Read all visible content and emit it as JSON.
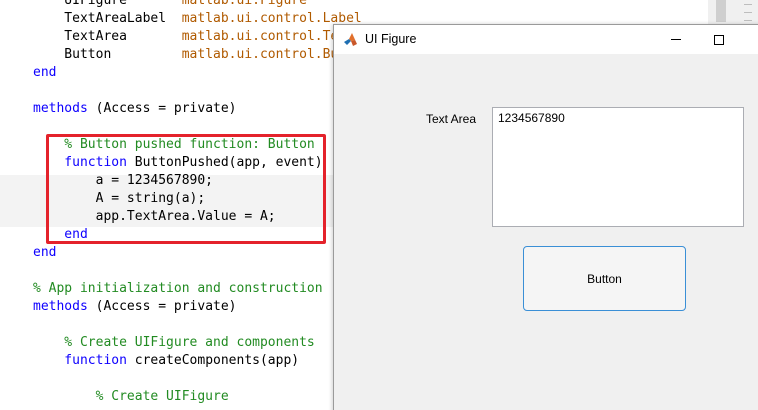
{
  "editor": {
    "lines": [
      {
        "segments": [
          {
            "cls": "plain",
            "text": "    UIFigure       "
          },
          {
            "cls": "cls",
            "text": "matlab.ui.Figure"
          }
        ]
      },
      {
        "segments": [
          {
            "cls": "plain",
            "text": "    TextAreaLabel  "
          },
          {
            "cls": "cls",
            "text": "matlab.ui.control.Label"
          }
        ]
      },
      {
        "segments": [
          {
            "cls": "plain",
            "text": "    TextArea       "
          },
          {
            "cls": "cls",
            "text": "matlab.ui.control.TextArea"
          }
        ]
      },
      {
        "segments": [
          {
            "cls": "plain",
            "text": "    Button         "
          },
          {
            "cls": "cls",
            "text": "matlab.ui.control.Button"
          }
        ]
      },
      {
        "segments": [
          {
            "cls": "kw",
            "text": "end"
          }
        ]
      },
      {
        "segments": [
          {
            "cls": "plain",
            "text": ""
          }
        ]
      },
      {
        "segments": [
          {
            "cls": "kw",
            "text": "methods"
          },
          {
            "cls": "plain",
            "text": " (Access = private)"
          }
        ]
      },
      {
        "segments": [
          {
            "cls": "plain",
            "text": ""
          }
        ]
      },
      {
        "segments": [
          {
            "cls": "cm",
            "text": "    % Button pushed function: Button"
          }
        ]
      },
      {
        "segments": [
          {
            "cls": "kw",
            "text": "    function"
          },
          {
            "cls": "plain",
            "text": " ButtonPushed(app, event)"
          }
        ]
      },
      {
        "segments": [
          {
            "cls": "plain",
            "text": "        a = 1234567890;"
          }
        ]
      },
      {
        "segments": [
          {
            "cls": "plain",
            "text": "        A = string(a);"
          }
        ]
      },
      {
        "segments": [
          {
            "cls": "plain",
            "text": "        app.TextArea.Value = A;"
          }
        ]
      },
      {
        "segments": [
          {
            "cls": "kw",
            "text": "    end"
          }
        ]
      },
      {
        "segments": [
          {
            "cls": "kw",
            "text": "end"
          }
        ]
      },
      {
        "segments": [
          {
            "cls": "plain",
            "text": ""
          }
        ]
      },
      {
        "segments": [
          {
            "cls": "cm",
            "text": "% App initialization and construction"
          }
        ]
      },
      {
        "segments": [
          {
            "cls": "kw",
            "text": "methods"
          },
          {
            "cls": "plain",
            "text": " (Access = private)"
          }
        ]
      },
      {
        "segments": [
          {
            "cls": "plain",
            "text": ""
          }
        ]
      },
      {
        "segments": [
          {
            "cls": "cm",
            "text": "    % Create UIFigure and components"
          }
        ]
      },
      {
        "segments": [
          {
            "cls": "kw",
            "text": "    function"
          },
          {
            "cls": "plain",
            "text": " createComponents(app)"
          }
        ]
      },
      {
        "segments": [
          {
            "cls": "plain",
            "text": ""
          }
        ]
      },
      {
        "segments": [
          {
            "cls": "cm",
            "text": "        % Create UIFigure"
          }
        ]
      }
    ]
  },
  "window": {
    "title": "UI Figure",
    "icon": "matlab-icon",
    "minimize_icon": "minimize-icon",
    "maximize_icon": "maximize-icon"
  },
  "form": {
    "text_area_label": "Text Area",
    "text_area_value": "1234567890",
    "button_label": "Button"
  },
  "colors": {
    "keyword": "#0e00ff",
    "comment": "#228b22",
    "class_name": "#b05a00",
    "highlight_box": "#e4222b",
    "button_border": "#3a8fd6"
  }
}
